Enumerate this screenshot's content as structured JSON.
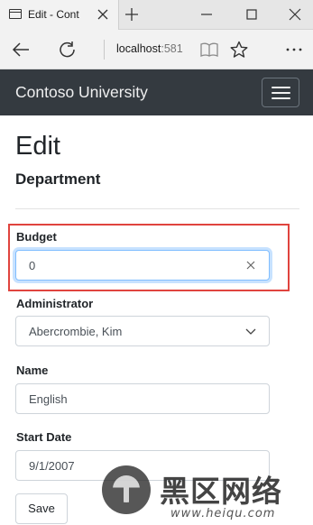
{
  "browser": {
    "tab_title": "Edit - Cont",
    "url_host": "localhost",
    "url_port": ":581"
  },
  "navbar": {
    "brand": "Contoso University"
  },
  "page": {
    "title": "Edit",
    "subtitle": "Department"
  },
  "form": {
    "budget_label": "Budget",
    "budget_value": "0",
    "administrator_label": "Administrator",
    "administrator_value": "Abercrombie, Kim",
    "name_label": "Name",
    "name_value": "English",
    "start_date_label": "Start Date",
    "start_date_value": "9/1/2007",
    "save_label": "Save"
  },
  "colors": {
    "navbar_bg": "#343a40",
    "highlight": "#e0443e",
    "focus_border": "#80bdff"
  },
  "watermark": {
    "chinese": "黑区网络",
    "url": "www.heiqu.com"
  }
}
